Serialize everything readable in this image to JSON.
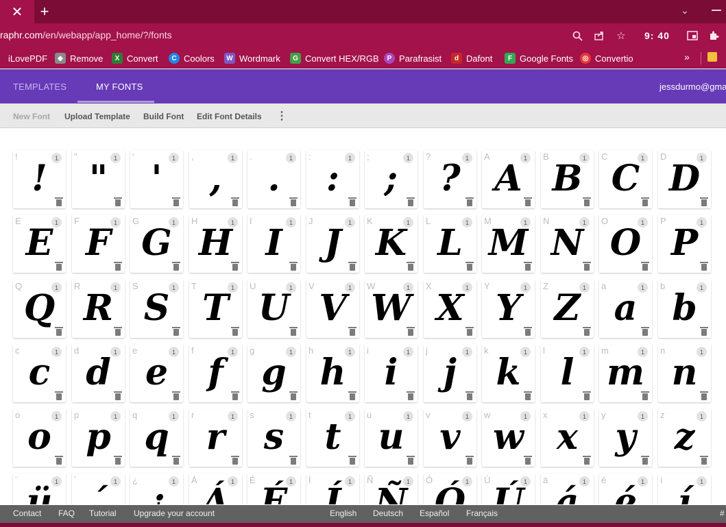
{
  "browser": {
    "url_domain": "raphr.com",
    "url_path": "/en/webapp/app_home/?/fonts",
    "clock": "9: 40",
    "bookmarks": [
      {
        "label": "iLovePDF",
        "icon": "ilovepdf-icon",
        "color": "#e2483d"
      },
      {
        "label": "Remove",
        "icon": "remove-bg-icon",
        "color": "#6c6c6c"
      },
      {
        "label": "Convert",
        "icon": "convert-icon",
        "color": "#2e7d32"
      },
      {
        "label": "Coolors",
        "icon": "coolors-icon",
        "color": "#1e88e5"
      },
      {
        "label": "Wordmark",
        "icon": "wordmark-icon",
        "color": "#5e35b1"
      },
      {
        "label": "Convert HEX/RGB",
        "icon": "hex-rgb-icon",
        "color": "#43a047"
      },
      {
        "label": "Parafrasist",
        "icon": "parafrasist-icon",
        "color": "#ab47bc"
      },
      {
        "label": "Dafont",
        "icon": "dafont-icon",
        "color": "#c62828"
      },
      {
        "label": "Google Fonts",
        "icon": "google-fonts-icon",
        "color": "#fbbc05"
      },
      {
        "label": "Convertio",
        "icon": "convertio-icon",
        "color": "#e53935"
      }
    ]
  },
  "app": {
    "tabs": [
      {
        "label": "TEMPLATES"
      },
      {
        "label": "MY FONTS"
      }
    ],
    "user_email": "jessdurmo@gmail",
    "actions": [
      {
        "label": "New Font"
      },
      {
        "label": "Upload Template"
      },
      {
        "label": "Build Font"
      },
      {
        "label": "Edit Font Details"
      }
    ],
    "colors": {
      "header": "#673ab7",
      "browser": "#a3124a"
    }
  },
  "glyphs": [
    {
      "char": "!",
      "glyph": "!",
      "count": "1"
    },
    {
      "char": "\"",
      "glyph": "\"",
      "count": "1"
    },
    {
      "char": "'",
      "glyph": "'",
      "count": "1"
    },
    {
      "char": ",",
      "glyph": ",",
      "count": "1"
    },
    {
      "char": ".",
      "glyph": ".",
      "count": "1"
    },
    {
      "char": ":",
      "glyph": ":",
      "count": "1"
    },
    {
      "char": ";",
      "glyph": ";",
      "count": "1"
    },
    {
      "char": "?",
      "glyph": "?",
      "count": "1"
    },
    {
      "char": "A",
      "glyph": "A",
      "count": "1"
    },
    {
      "char": "B",
      "glyph": "B",
      "count": "1"
    },
    {
      "char": "C",
      "glyph": "C",
      "count": "1"
    },
    {
      "char": "D",
      "glyph": "D",
      "count": "1"
    },
    {
      "char": "E",
      "glyph": "E",
      "count": "1"
    },
    {
      "char": "F",
      "glyph": "F",
      "count": "1"
    },
    {
      "char": "G",
      "glyph": "G",
      "count": "1"
    },
    {
      "char": "H",
      "glyph": "H",
      "count": "1"
    },
    {
      "char": "I",
      "glyph": "I",
      "count": "1"
    },
    {
      "char": "J",
      "glyph": "J",
      "count": "1"
    },
    {
      "char": "K",
      "glyph": "K",
      "count": "1"
    },
    {
      "char": "L",
      "glyph": "L",
      "count": "1"
    },
    {
      "char": "M",
      "glyph": "M",
      "count": "1"
    },
    {
      "char": "N",
      "glyph": "N",
      "count": "1"
    },
    {
      "char": "O",
      "glyph": "O",
      "count": "1"
    },
    {
      "char": "P",
      "glyph": "P",
      "count": "1"
    },
    {
      "char": "Q",
      "glyph": "Q",
      "count": "1"
    },
    {
      "char": "R",
      "glyph": "R",
      "count": "1"
    },
    {
      "char": "S",
      "glyph": "S",
      "count": "1"
    },
    {
      "char": "T",
      "glyph": "T",
      "count": "1"
    },
    {
      "char": "U",
      "glyph": "U",
      "count": "1"
    },
    {
      "char": "V",
      "glyph": "V",
      "count": "1"
    },
    {
      "char": "W",
      "glyph": "W",
      "count": "1"
    },
    {
      "char": "X",
      "glyph": "X",
      "count": "1"
    },
    {
      "char": "Y",
      "glyph": "Y",
      "count": "1"
    },
    {
      "char": "Z",
      "glyph": "Z",
      "count": "1"
    },
    {
      "char": "a",
      "glyph": "a",
      "count": "1"
    },
    {
      "char": "b",
      "glyph": "b",
      "count": "1"
    },
    {
      "char": "c",
      "glyph": "c",
      "count": "1"
    },
    {
      "char": "d",
      "glyph": "d",
      "count": "1"
    },
    {
      "char": "e",
      "glyph": "e",
      "count": "1"
    },
    {
      "char": "f",
      "glyph": "f",
      "count": "1"
    },
    {
      "char": "g",
      "glyph": "g",
      "count": "1"
    },
    {
      "char": "h",
      "glyph": "h",
      "count": "1"
    },
    {
      "char": "i",
      "glyph": "i",
      "count": "1"
    },
    {
      "char": "j",
      "glyph": "j",
      "count": "1"
    },
    {
      "char": "k",
      "glyph": "k",
      "count": "1"
    },
    {
      "char": "l",
      "glyph": "l",
      "count": "1"
    },
    {
      "char": "m",
      "glyph": "m",
      "count": "1"
    },
    {
      "char": "n",
      "glyph": "n",
      "count": "1"
    },
    {
      "char": "o",
      "glyph": "o",
      "count": "1"
    },
    {
      "char": "p",
      "glyph": "p",
      "count": "1"
    },
    {
      "char": "q",
      "glyph": "q",
      "count": "1"
    },
    {
      "char": "r",
      "glyph": "r",
      "count": "1"
    },
    {
      "char": "s",
      "glyph": "s",
      "count": "1"
    },
    {
      "char": "t",
      "glyph": "t",
      "count": "1"
    },
    {
      "char": "u",
      "glyph": "u",
      "count": "1"
    },
    {
      "char": "v",
      "glyph": "v",
      "count": "1"
    },
    {
      "char": "w",
      "glyph": "w",
      "count": "1"
    },
    {
      "char": "x",
      "glyph": "x",
      "count": "1"
    },
    {
      "char": "y",
      "glyph": "y",
      "count": "1"
    },
    {
      "char": "z",
      "glyph": "z",
      "count": "1"
    },
    {
      "char": "¨",
      "glyph": "ü",
      "count": "1"
    },
    {
      "char": "´",
      "glyph": "´",
      "count": "1"
    },
    {
      "char": "¿",
      "glyph": "¿",
      "count": "1"
    },
    {
      "char": "Á",
      "glyph": "Á",
      "count": "1"
    },
    {
      "char": "É",
      "glyph": "É",
      "count": "1"
    },
    {
      "char": "Í",
      "glyph": "Í",
      "count": "1"
    },
    {
      "char": "Ñ",
      "glyph": "Ñ",
      "count": "1"
    },
    {
      "char": "Ó",
      "glyph": "Ó",
      "count": "1"
    },
    {
      "char": "Ú",
      "glyph": "Ú",
      "count": "1"
    },
    {
      "char": "á",
      "glyph": "á",
      "count": "1"
    },
    {
      "char": "é",
      "glyph": "é",
      "count": "1"
    },
    {
      "char": "í",
      "glyph": "í",
      "count": "1"
    }
  ],
  "footer": {
    "links": [
      {
        "label": "Contact"
      },
      {
        "label": "FAQ"
      },
      {
        "label": "Tutorial"
      },
      {
        "label": "Upgrade your account"
      }
    ],
    "languages": [
      {
        "label": "English"
      },
      {
        "label": "Deutsch"
      },
      {
        "label": "Español"
      },
      {
        "label": "Français"
      }
    ],
    "extra": "#"
  }
}
